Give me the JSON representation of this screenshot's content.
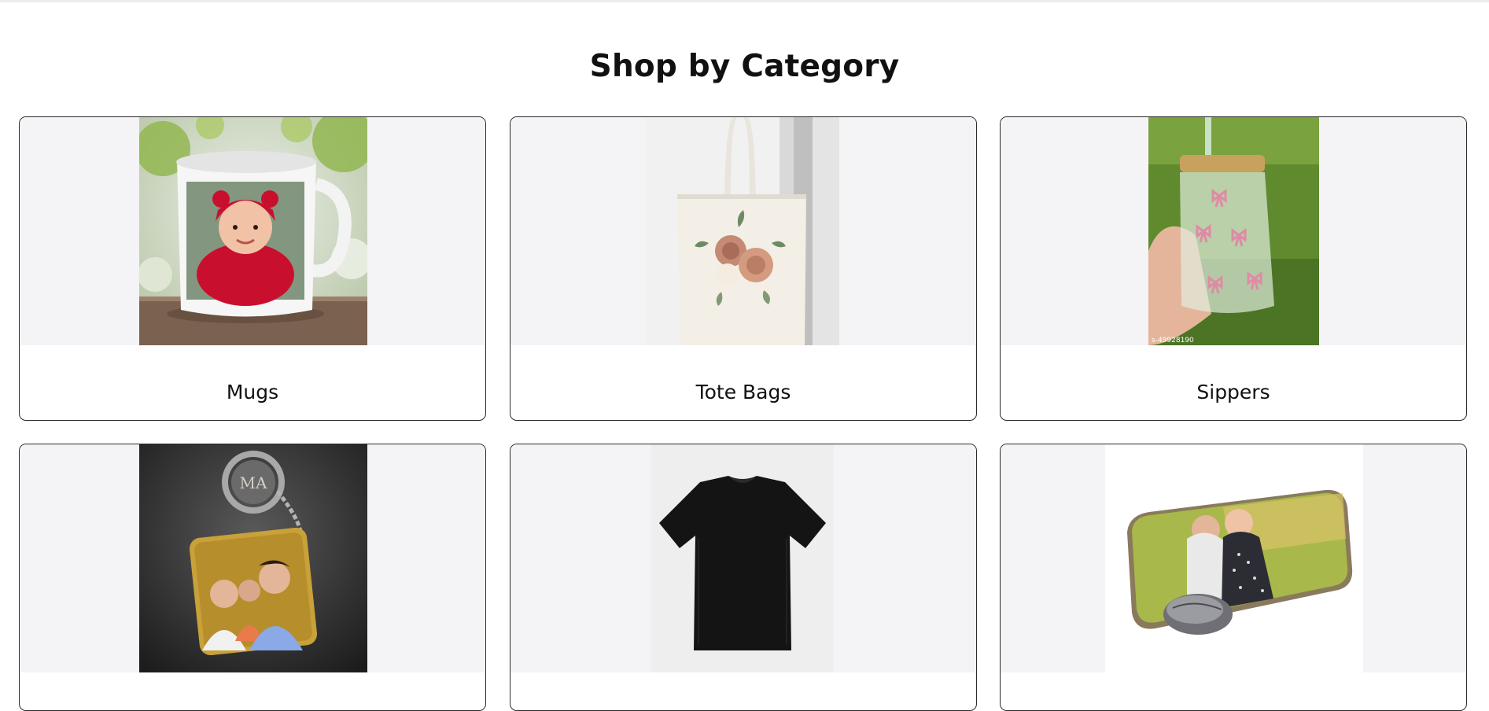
{
  "page": {
    "title": "Shop by Category"
  },
  "categories": [
    {
      "label": "Mugs",
      "image": "mug-photo"
    },
    {
      "label": "Tote Bags",
      "image": "tote-bag-photo"
    },
    {
      "label": "Sippers",
      "image": "sipper-photo",
      "watermark": "s-49928190"
    },
    {
      "label": "",
      "image": "keychain-photo",
      "engraving": "MA"
    },
    {
      "label": "",
      "image": "tshirt-photo"
    },
    {
      "label": "",
      "image": "mousepad-photo"
    }
  ],
  "colors": {
    "card_border": "#2a2a2a",
    "media_bg": "#f4f3f5",
    "text": "#111111"
  }
}
